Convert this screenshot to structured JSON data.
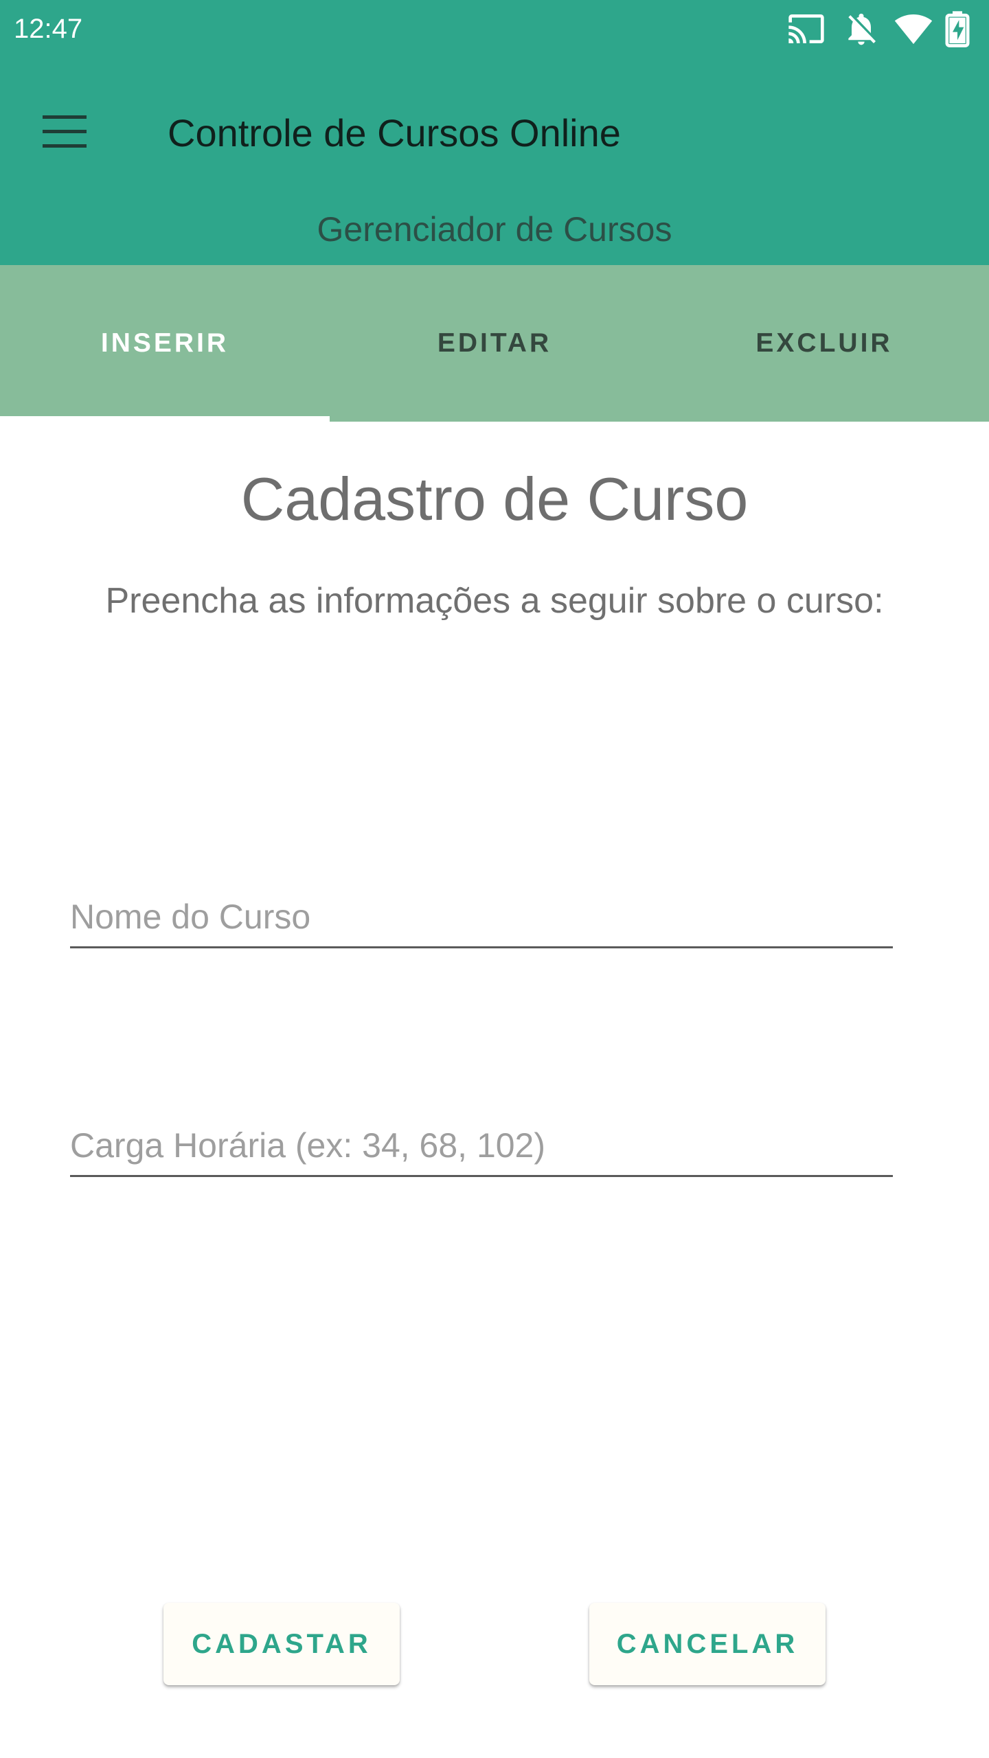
{
  "status_bar": {
    "time": "12:47",
    "icons": [
      "cast-icon",
      "notifications-off-icon",
      "wifi-icon",
      "battery-charging-icon"
    ]
  },
  "app_bar": {
    "menu_icon": "menu-icon",
    "title": "Controle de Cursos Online",
    "subtitle": "Gerenciador de Cursos"
  },
  "tabs": [
    {
      "label": "INSERIR",
      "active": true
    },
    {
      "label": "EDITAR",
      "active": false
    },
    {
      "label": "EXCLUIR",
      "active": false
    }
  ],
  "form": {
    "title": "Cadastro de Curso",
    "instruction": "Preencha as informações a seguir sobre o curso:",
    "nome_placeholder": "Nome do Curso",
    "nome_value": "",
    "carga_placeholder": "Carga Horária (ex: 34, 68, 102)",
    "carga_value": ""
  },
  "buttons": {
    "cadastrar_label": "CADASTAR",
    "cancelar_label": "CANCELAR"
  },
  "colors": {
    "primary": "#2ea68b",
    "tab_bar": "#87bc9a",
    "tab_active_text": "#ffffff",
    "tab_inactive_text": "#34473e",
    "button_text": "#2ea68b"
  }
}
